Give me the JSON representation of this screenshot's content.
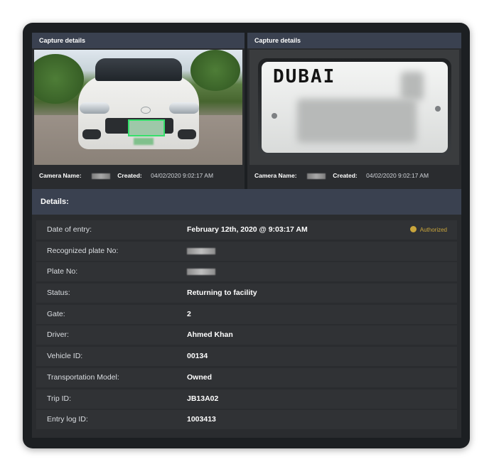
{
  "left_panel": {
    "title": "Capture details",
    "camera_label": "Camera Name:",
    "created_label": "Created:",
    "created_value": "04/02/2020 9:02:17 AM"
  },
  "right_panel": {
    "title": "Capture details",
    "plate_text": "DUBAI",
    "camera_label": "Camera Name:",
    "created_label": "Created:",
    "created_value": "04/02/2020 9:02:17 AM"
  },
  "details": {
    "title": "Details:",
    "authorized_label": "Authorized",
    "accent_color": "#c9a53c",
    "rows": [
      {
        "label": "Date of entry:",
        "value": "February 12th, 2020 @ 9:03:17 AM"
      },
      {
        "label": "Recognized plate No:",
        "value": ""
      },
      {
        "label": "Plate No:",
        "value": ""
      },
      {
        "label": "Status:",
        "value": "Returning to facility"
      },
      {
        "label": "Gate:",
        "value": "2"
      },
      {
        "label": "Driver:",
        "value": "Ahmed Khan"
      },
      {
        "label": "Vehicle ID:",
        "value": "00134"
      },
      {
        "label": "Transportation Model:",
        "value": "Owned"
      },
      {
        "label": "Trip ID:",
        "value": "JB13A02"
      },
      {
        "label": "Entry log ID:",
        "value": "1003413"
      }
    ]
  }
}
